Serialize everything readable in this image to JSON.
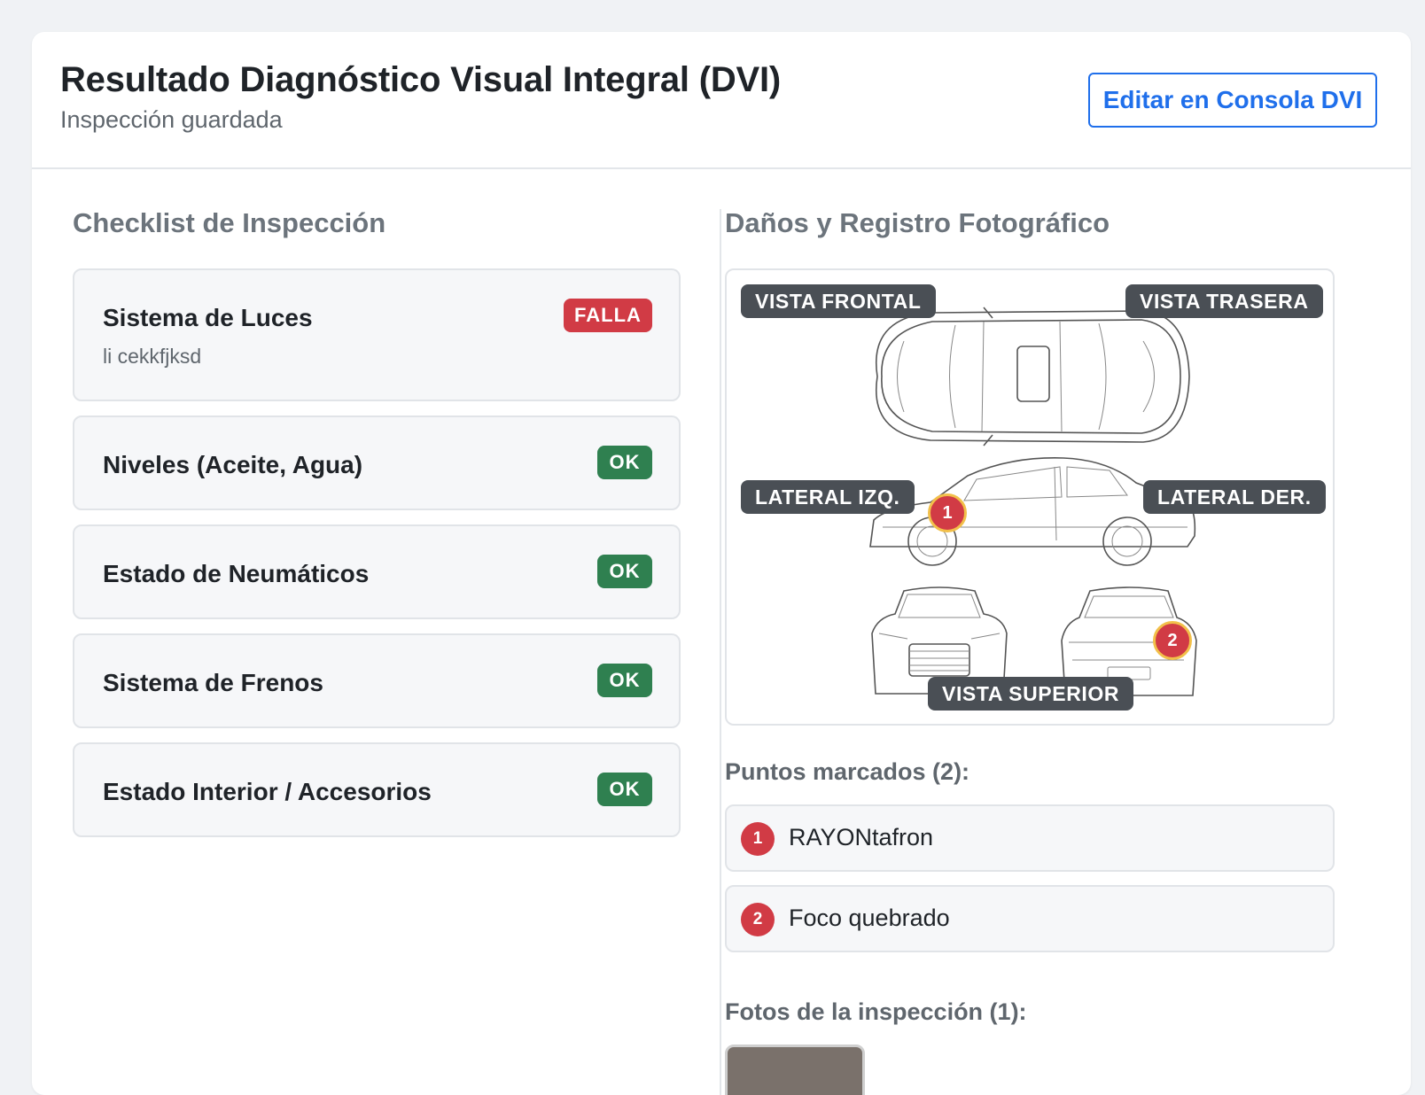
{
  "header": {
    "title": "Resultado Diagnóstico Visual Integral (DVI)",
    "subtitle": "Inspección guardada",
    "edit_button_label": "Editar en Consola DVI"
  },
  "checklist": {
    "title": "Checklist de Inspección",
    "items": [
      {
        "name": "Sistema de Luces",
        "status": "FALLA",
        "note": "li cekkfjksd"
      },
      {
        "name": "Niveles (Aceite, Agua)",
        "status": "OK"
      },
      {
        "name": "Estado de Neumáticos",
        "status": "OK"
      },
      {
        "name": "Sistema de Frenos",
        "status": "OK"
      },
      {
        "name": "Estado Interior / Accesorios",
        "status": "OK"
      }
    ]
  },
  "damage": {
    "title": "Daños y Registro Fotográfico",
    "views": {
      "front": "VISTA FRONTAL",
      "rear": "VISTA TRASERA",
      "left": "LATERAL IZQ.",
      "right": "LATERAL DER.",
      "top": "VISTA SUPERIOR"
    },
    "markers": [
      "1",
      "2"
    ],
    "points_title": "Puntos marcados (2):",
    "points": [
      {
        "num": "1",
        "text": "RAYONtafron"
      },
      {
        "num": "2",
        "text": "Foco quebrado"
      }
    ],
    "photos_title": "Fotos de la inspección (1):"
  },
  "colors": {
    "fail": "#d13b45",
    "ok": "#2f8050",
    "accent": "#1f6feb",
    "marker_ring": "#f2c04a"
  }
}
